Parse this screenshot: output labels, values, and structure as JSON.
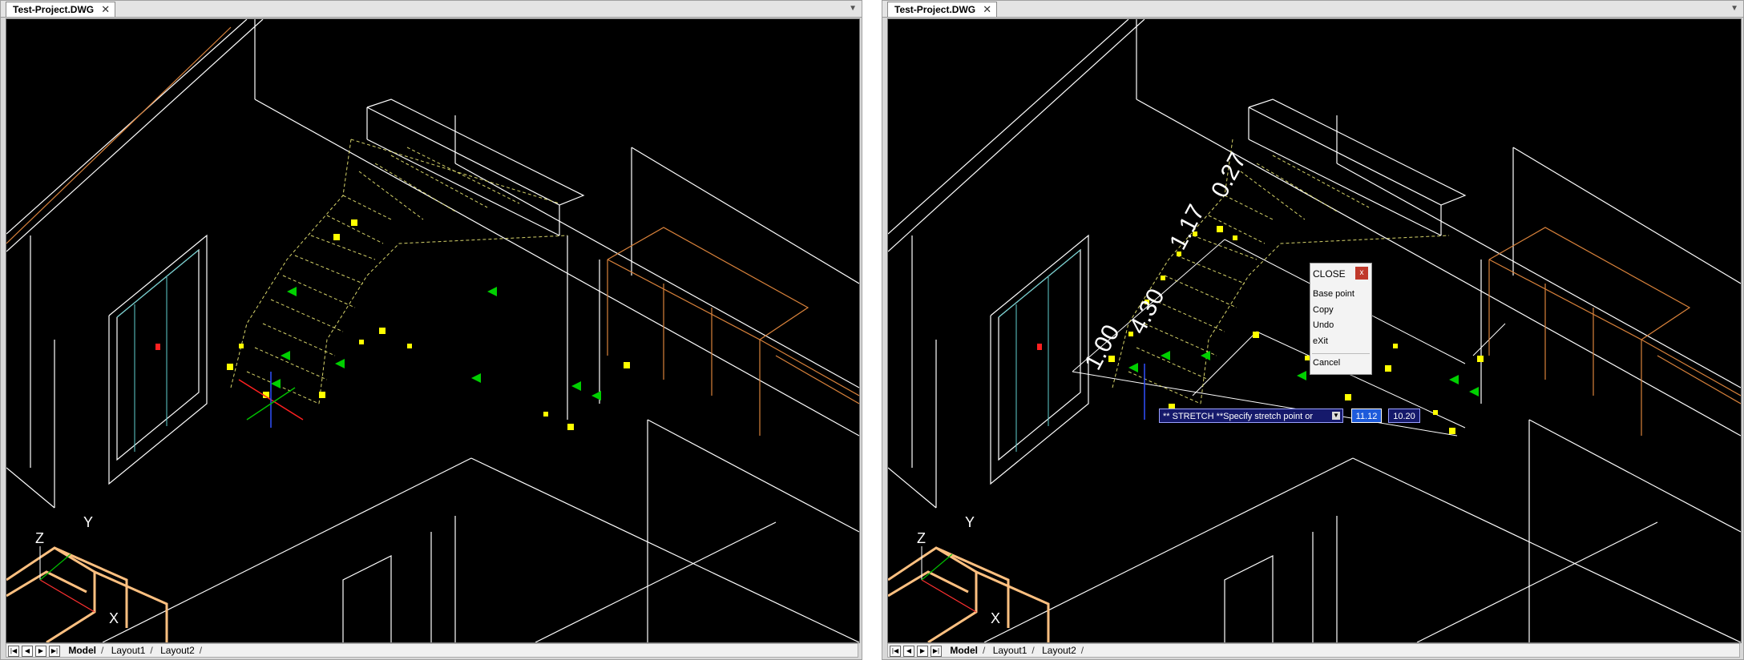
{
  "left_window": {
    "tab_title": "Test-Project.DWG",
    "close_symbol": "✕",
    "layout_tabs": [
      "Model",
      "Layout1",
      "Layout2"
    ],
    "axis_labels": {
      "z": "Z",
      "y": "Y",
      "x": "X"
    }
  },
  "right_window": {
    "tab_title": "Test-Project.DWG",
    "close_symbol": "✕",
    "layout_tabs": [
      "Model",
      "Layout1",
      "Layout2"
    ],
    "axis_labels": {
      "z": "Z",
      "y": "Y",
      "x": "X"
    },
    "dimensions": [
      "1.00",
      "4.30",
      "1.17",
      "0.27"
    ],
    "context_menu": {
      "title": "CLOSE",
      "close_symbol": "x",
      "items": [
        "Base point",
        "Copy",
        "Undo",
        "eXit",
        "Cancel"
      ]
    },
    "command_prompt": "** STRETCH **Specify stretch point or",
    "input_x": "11.12",
    "input_y": "10.20"
  },
  "colors": {
    "background": "#000000",
    "wall": "#ffffff",
    "orange": "#d9823b",
    "stairs": "#d6d36a",
    "grip": "#ffff00",
    "arrow": "#00d000",
    "cyan": "#3fc4c4"
  }
}
